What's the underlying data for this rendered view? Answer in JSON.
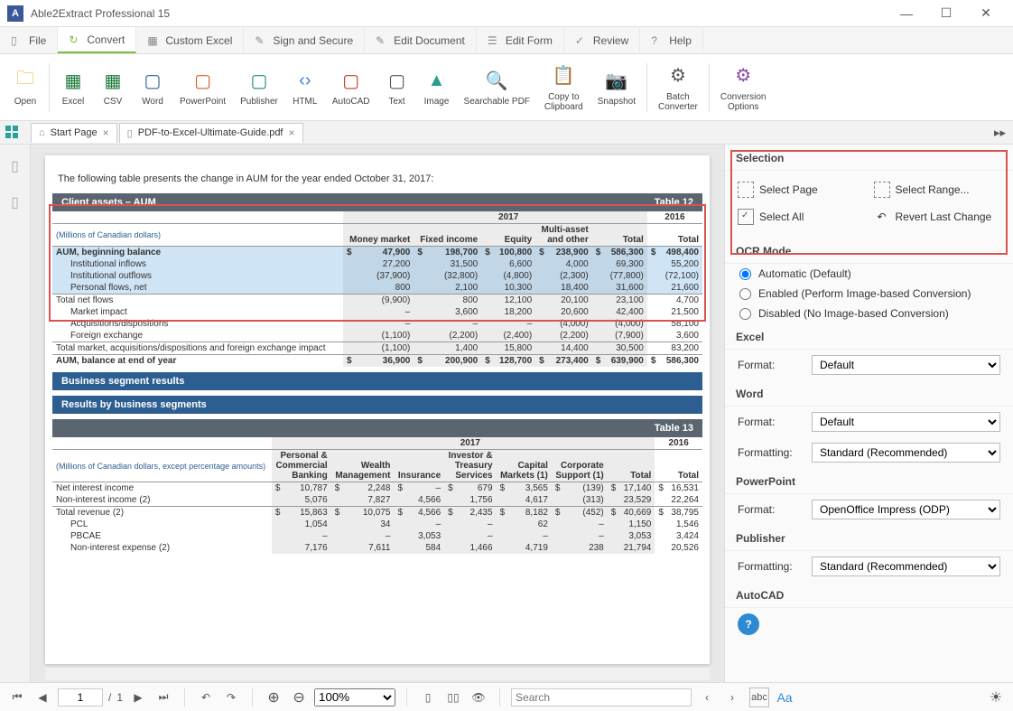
{
  "app_title": "Able2Extract Professional 15",
  "menu": [
    "File",
    "Convert",
    "Custom Excel",
    "Sign and Secure",
    "Edit Document",
    "Edit Form",
    "Review",
    "Help"
  ],
  "ribbon": [
    {
      "label": "Open",
      "color": "#f5a623",
      "icon": "folder"
    },
    {
      "sep": true
    },
    {
      "label": "Excel",
      "color": "#1e7b3a",
      "icon": "grid"
    },
    {
      "label": "CSV",
      "color": "#1e7b3a",
      "icon": "grid"
    },
    {
      "label": "Word",
      "color": "#2d5e91",
      "icon": "doc"
    },
    {
      "label": "PowerPoint",
      "color": "#d85c2a",
      "icon": "doc"
    },
    {
      "label": "Publisher",
      "color": "#1a8a78",
      "icon": "doc"
    },
    {
      "label": "HTML",
      "color": "#3b7dd8",
      "icon": "code"
    },
    {
      "label": "AutoCAD",
      "color": "#c0392b",
      "icon": "doc"
    },
    {
      "label": "Text",
      "color": "#555",
      "icon": "doc"
    },
    {
      "label": "Image",
      "color": "#2a9d8f",
      "icon": "img"
    },
    {
      "label": "Searchable PDF",
      "color": "#444",
      "icon": "search"
    },
    {
      "label": "Copy to\nClipboard",
      "color": "#555",
      "icon": "clip"
    },
    {
      "label": "Snapshot",
      "color": "#555",
      "icon": "cam"
    },
    {
      "sep": true
    },
    {
      "label": "Batch\nConverter",
      "color": "#555",
      "icon": "gear"
    },
    {
      "sep": true
    },
    {
      "label": "Conversion\nOptions",
      "color": "#8e44ad",
      "icon": "gear"
    }
  ],
  "tabs": [
    {
      "label": "Start Page",
      "icon": "home"
    },
    {
      "label": "PDF-to-Excel-Ultimate-Guide.pdf",
      "icon": "doc"
    }
  ],
  "intro_text": "The following table presents the change in AUM for the year ended October 31, 2017:",
  "table1": {
    "title": "Client assets – AUM",
    "table_label": "Table 12",
    "year1": "2017",
    "year2": "2016",
    "cols": [
      "Money market",
      "Fixed income",
      "Equity",
      "Multi-asset\nand other",
      "Total",
      "Total"
    ],
    "note": "(Millions of Canadian dollars)",
    "rows": [
      {
        "l": "AUM, beginning balance",
        "v": [
          "47,900",
          "198,700",
          "100,800",
          "238,900",
          "586,300",
          "498,400"
        ],
        "d": true,
        "hl": true,
        "b": true
      },
      {
        "l": "Institutional inflows",
        "v": [
          "27,200",
          "31,500",
          "6,600",
          "4,000",
          "69,300",
          "55,200"
        ],
        "ind": 1,
        "hl": true
      },
      {
        "l": "Institutional outflows",
        "v": [
          "(37,900)",
          "(32,800)",
          "(4,800)",
          "(2,300)",
          "(77,800)",
          "(72,100)"
        ],
        "ind": 1,
        "hl": true
      },
      {
        "l": "Personal flows, net",
        "v": [
          "800",
          "2,100",
          "10,300",
          "18,400",
          "31,600",
          "21,600"
        ],
        "ind": 1,
        "hl": true
      },
      {
        "l": "Total net flows",
        "v": [
          "(9,900)",
          "800",
          "12,100",
          "20,100",
          "23,100",
          "4,700"
        ],
        "sep": true
      },
      {
        "l": "Market impact",
        "v": [
          "–",
          "3,600",
          "18,200",
          "20,600",
          "42,400",
          "21,500"
        ],
        "ind": 1
      },
      {
        "l": "Acquisitions/dispositions",
        "v": [
          "–",
          "–",
          "–",
          "(4,000)",
          "(4,000)",
          "58,100"
        ],
        "ind": 1
      },
      {
        "l": "Foreign exchange",
        "v": [
          "(1,100)",
          "(2,200)",
          "(2,400)",
          "(2,200)",
          "(7,900)",
          "3,600"
        ],
        "ind": 1
      },
      {
        "l": "Total market, acquisitions/dispositions and foreign exchange impact",
        "v": [
          "(1,100)",
          "1,400",
          "15,800",
          "14,400",
          "30,500",
          "83,200"
        ],
        "sep": true,
        "wrap": true
      },
      {
        "l": "AUM, balance at end of year",
        "v": [
          "36,900",
          "200,900",
          "128,700",
          "273,400",
          "639,900",
          "586,300"
        ],
        "d": true,
        "sep": true,
        "b": true
      }
    ]
  },
  "bar_biz": "Business segment results",
  "bar_res": "Results by business segments",
  "table2": {
    "table_label": "Table 13",
    "year1": "2017",
    "year2": "2016",
    "cols": [
      "Personal &\nCommercial\nBanking",
      "Wealth\nManagement",
      "Insurance",
      "Investor &\nTreasury\nServices",
      "Capital\nMarkets (1)",
      "Corporate\nSupport (1)",
      "Total",
      "Total"
    ],
    "note": "(Millions of Canadian dollars, except percentage amounts)",
    "rows": [
      {
        "l": "Net interest income",
        "v": [
          "10,787",
          "2,248",
          "–",
          "679",
          "3,565",
          "(139)",
          "17,140",
          "16,531"
        ],
        "d": true
      },
      {
        "l": "Non-interest income (2)",
        "v": [
          "5,076",
          "7,827",
          "4,566",
          "1,756",
          "4,617",
          "(313)",
          "23,529",
          "22,264"
        ]
      },
      {
        "l": "Total revenue (2)",
        "v": [
          "15,863",
          "10,075",
          "4,566",
          "2,435",
          "8,182",
          "(452)",
          "40,669",
          "38,795"
        ],
        "d": true,
        "sep": true
      },
      {
        "l": "PCL",
        "v": [
          "1,054",
          "34",
          "–",
          "–",
          "62",
          "–",
          "1,150",
          "1,546"
        ],
        "ind": 1
      },
      {
        "l": "PBCAE",
        "v": [
          "–",
          "–",
          "3,053",
          "–",
          "–",
          "–",
          "3,053",
          "3,424"
        ],
        "ind": 1
      },
      {
        "l": "Non-interest expense (2)",
        "v": [
          "7,176",
          "7,611",
          "584",
          "1,466",
          "4,719",
          "238",
          "21,794",
          "20,526"
        ],
        "ind": 1
      }
    ]
  },
  "right": {
    "sel_h": "Selection",
    "sel_page": "Select Page",
    "sel_range": "Select Range...",
    "sel_all": "Select All",
    "revert": "Revert Last Change",
    "ocr_h": "OCR Mode",
    "ocr_opts": [
      "Automatic (Default)",
      "Enabled (Perform Image-based Conversion)",
      "Disabled (No Image-based Conversion)"
    ],
    "excel_h": "Excel",
    "word_h": "Word",
    "pp_h": "PowerPoint",
    "pub_h": "Publisher",
    "acad_h": "AutoCAD",
    "format_l": "Format:",
    "formatting_l": "Formatting:",
    "excel_fmt": "Default",
    "word_fmt": "Default",
    "word_fmt2": "Standard (Recommended)",
    "pp_fmt": "OpenOffice Impress (ODP)",
    "pub_fmt": "Standard (Recommended)"
  },
  "status": {
    "page_cur": "1",
    "page_tot": "1",
    "zoom": "100%",
    "search_ph": "Search"
  }
}
